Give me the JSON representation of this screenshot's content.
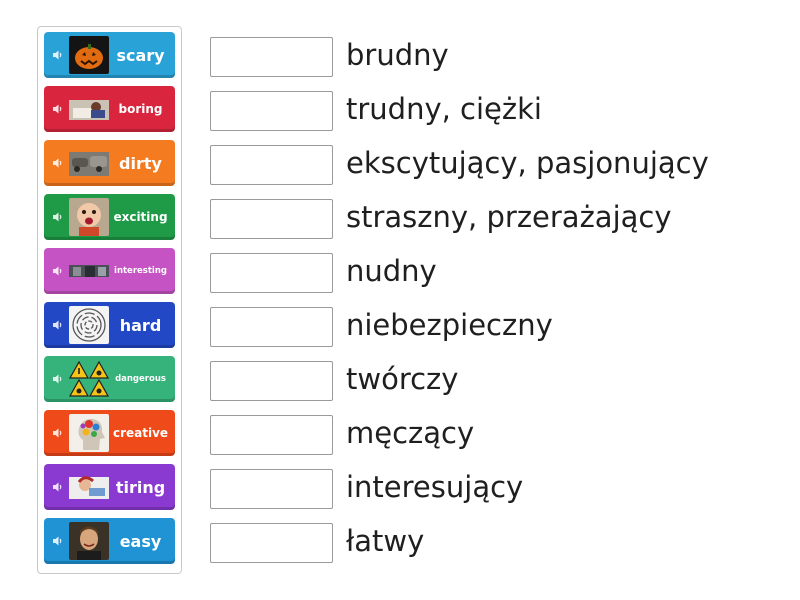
{
  "tiles": [
    {
      "word": "scary",
      "color": "#29a3d7",
      "icon": "pumpkin-thumbnail"
    },
    {
      "word": "boring",
      "color": "#d9263e",
      "icon": "bored-student-thumbnail"
    },
    {
      "word": "dirty",
      "color": "#f47b20",
      "icon": "dirty-cars-thumbnail"
    },
    {
      "word": "exciting",
      "color": "#1f9a47",
      "icon": "excited-baby-thumbnail"
    },
    {
      "word": "interesting",
      "color": "#c653c4",
      "icon": "interesting-scene-thumbnail"
    },
    {
      "word": "hard",
      "color": "#2348c5",
      "icon": "maze-thumbnail"
    },
    {
      "word": "dangerous",
      "color": "#35b37a",
      "icon": "warning-signs-thumbnail"
    },
    {
      "word": "creative",
      "color": "#ee4a1a",
      "icon": "creative-head-thumbnail"
    },
    {
      "word": "tiring",
      "color": "#8a3ad0",
      "icon": "tired-person-thumbnail"
    },
    {
      "word": "easy",
      "color": "#1f93d3",
      "icon": "smiling-man-thumbnail"
    }
  ],
  "definitions": [
    "brudny",
    "trudny, ciężki",
    "ekscytujący, pasjonujący",
    "straszny, przerażający",
    "nudny",
    "niebezpieczny",
    "twórczy",
    "męczący",
    "interesujący",
    "łatwy"
  ]
}
